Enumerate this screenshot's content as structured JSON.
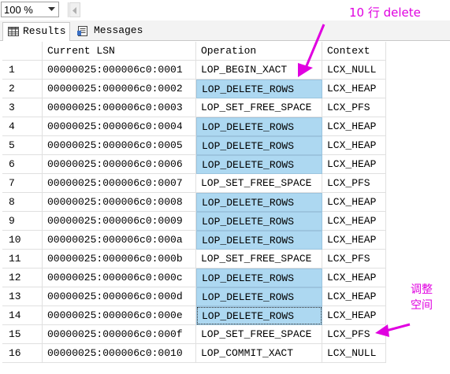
{
  "toolbar": {
    "zoom": "100 %"
  },
  "tabs": {
    "results": "Results",
    "messages": "Messages"
  },
  "grid": {
    "columns": [
      "",
      "Current LSN",
      "Operation",
      "Context"
    ],
    "rows": [
      {
        "num": "1",
        "lsn": "00000025:000006c0:0001",
        "op": "LOP_BEGIN_XACT",
        "ctx": "LCX_NULL"
      },
      {
        "num": "2",
        "lsn": "00000025:000006c0:0002",
        "op": "LOP_DELETE_ROWS",
        "ctx": "LCX_HEAP"
      },
      {
        "num": "3",
        "lsn": "00000025:000006c0:0003",
        "op": "LOP_SET_FREE_SPACE",
        "ctx": "LCX_PFS"
      },
      {
        "num": "4",
        "lsn": "00000025:000006c0:0004",
        "op": "LOP_DELETE_ROWS",
        "ctx": "LCX_HEAP"
      },
      {
        "num": "5",
        "lsn": "00000025:000006c0:0005",
        "op": "LOP_DELETE_ROWS",
        "ctx": "LCX_HEAP"
      },
      {
        "num": "6",
        "lsn": "00000025:000006c0:0006",
        "op": "LOP_DELETE_ROWS",
        "ctx": "LCX_HEAP"
      },
      {
        "num": "7",
        "lsn": "00000025:000006c0:0007",
        "op": "LOP_SET_FREE_SPACE",
        "ctx": "LCX_PFS"
      },
      {
        "num": "8",
        "lsn": "00000025:000006c0:0008",
        "op": "LOP_DELETE_ROWS",
        "ctx": "LCX_HEAP"
      },
      {
        "num": "9",
        "lsn": "00000025:000006c0:0009",
        "op": "LOP_DELETE_ROWS",
        "ctx": "LCX_HEAP"
      },
      {
        "num": "10",
        "lsn": "00000025:000006c0:000a",
        "op": "LOP_DELETE_ROWS",
        "ctx": "LCX_HEAP"
      },
      {
        "num": "11",
        "lsn": "00000025:000006c0:000b",
        "op": "LOP_SET_FREE_SPACE",
        "ctx": "LCX_PFS"
      },
      {
        "num": "12",
        "lsn": "00000025:000006c0:000c",
        "op": "LOP_DELETE_ROWS",
        "ctx": "LCX_HEAP"
      },
      {
        "num": "13",
        "lsn": "00000025:000006c0:000d",
        "op": "LOP_DELETE_ROWS",
        "ctx": "LCX_HEAP"
      },
      {
        "num": "14",
        "lsn": "00000025:000006c0:000e",
        "op": "LOP_DELETE_ROWS",
        "ctx": "LCX_HEAP"
      },
      {
        "num": "15",
        "lsn": "00000025:000006c0:000f",
        "op": "LOP_SET_FREE_SPACE",
        "ctx": "LCX_PFS"
      },
      {
        "num": "16",
        "lsn": "00000025:000006c0:0010",
        "op": "LOP_COMMIT_XACT",
        "ctx": "LCX_NULL"
      }
    ]
  },
  "annotations": {
    "top": "10 行 delete",
    "bottom_line1": "调整",
    "bottom_line2": "空间"
  },
  "colors": {
    "highlight": "#add8f1",
    "annotation": "#e000e0"
  }
}
